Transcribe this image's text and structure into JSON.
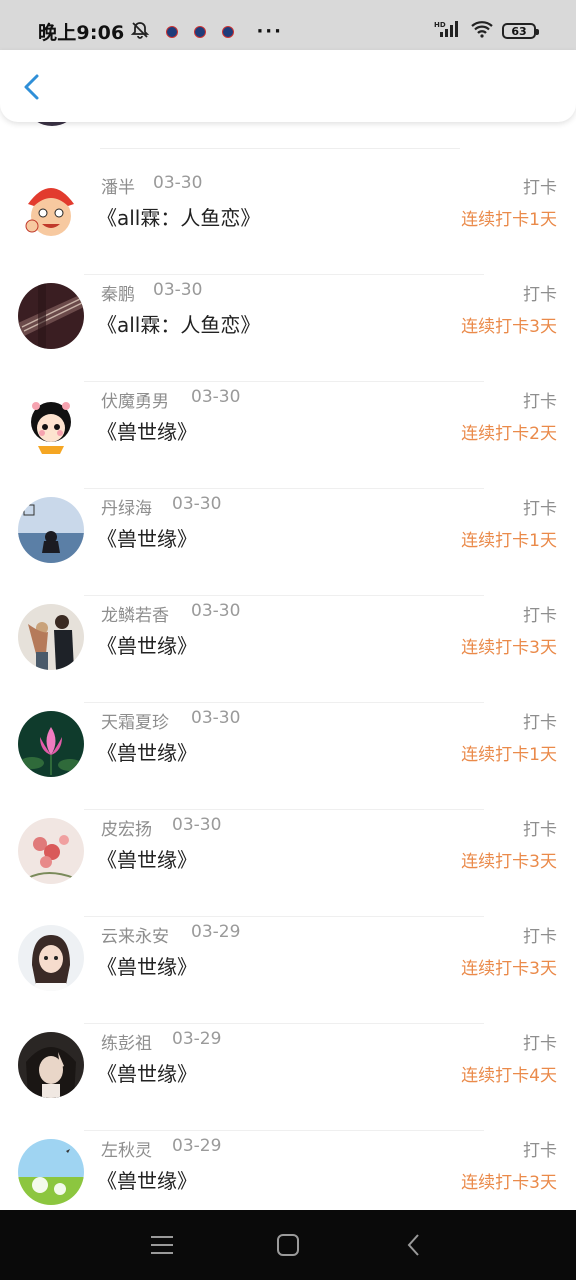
{
  "status_bar": {
    "time": "晚上9:06",
    "more": "···",
    "battery": "63",
    "icons": [
      "mute-bell-icon",
      "app-notification-icon",
      "signal-icon",
      "wifi-icon",
      "battery-icon"
    ]
  },
  "header": {
    "back_icon": "chevron-left-icon"
  },
  "checkins": [
    {
      "name": "潘半",
      "date": "03-30",
      "book": "《all霖：人鱼恋》",
      "label": "打卡",
      "streak": "连续打卡1天"
    },
    {
      "name": "秦鹏",
      "date": "03-30",
      "book": "《all霖：人鱼恋》",
      "label": "打卡",
      "streak": "连续打卡3天"
    },
    {
      "name": "伏魔勇男",
      "date": "03-30",
      "book": "《兽世缘》",
      "label": "打卡",
      "streak": "连续打卡2天"
    },
    {
      "name": "丹绿海",
      "date": "03-30",
      "book": "《兽世缘》",
      "label": "打卡",
      "streak": "连续打卡1天"
    },
    {
      "name": "龙鳞若香",
      "date": "03-30",
      "book": "《兽世缘》",
      "label": "打卡",
      "streak": "连续打卡3天"
    },
    {
      "name": "天霜夏珍",
      "date": "03-30",
      "book": "《兽世缘》",
      "label": "打卡",
      "streak": "连续打卡1天"
    },
    {
      "name": "皮宏扬",
      "date": "03-30",
      "book": "《兽世缘》",
      "label": "打卡",
      "streak": "连续打卡3天"
    },
    {
      "name": "云来永安",
      "date": "03-29",
      "book": "《兽世缘》",
      "label": "打卡",
      "streak": "连续打卡3天"
    },
    {
      "name": "练彭祖",
      "date": "03-29",
      "book": "《兽世缘》",
      "label": "打卡",
      "streak": "连续打卡4天"
    },
    {
      "name": "左秋灵",
      "date": "03-29",
      "book": "《兽世缘》",
      "label": "打卡",
      "streak": "连续打卡3天"
    }
  ],
  "nav_bar": {
    "icons": [
      "menu-icon",
      "home-icon",
      "back-icon"
    ]
  },
  "colors": {
    "accent": "#2f8fd8",
    "streak": "#ea8a4a",
    "muted": "#8e8e8e"
  }
}
